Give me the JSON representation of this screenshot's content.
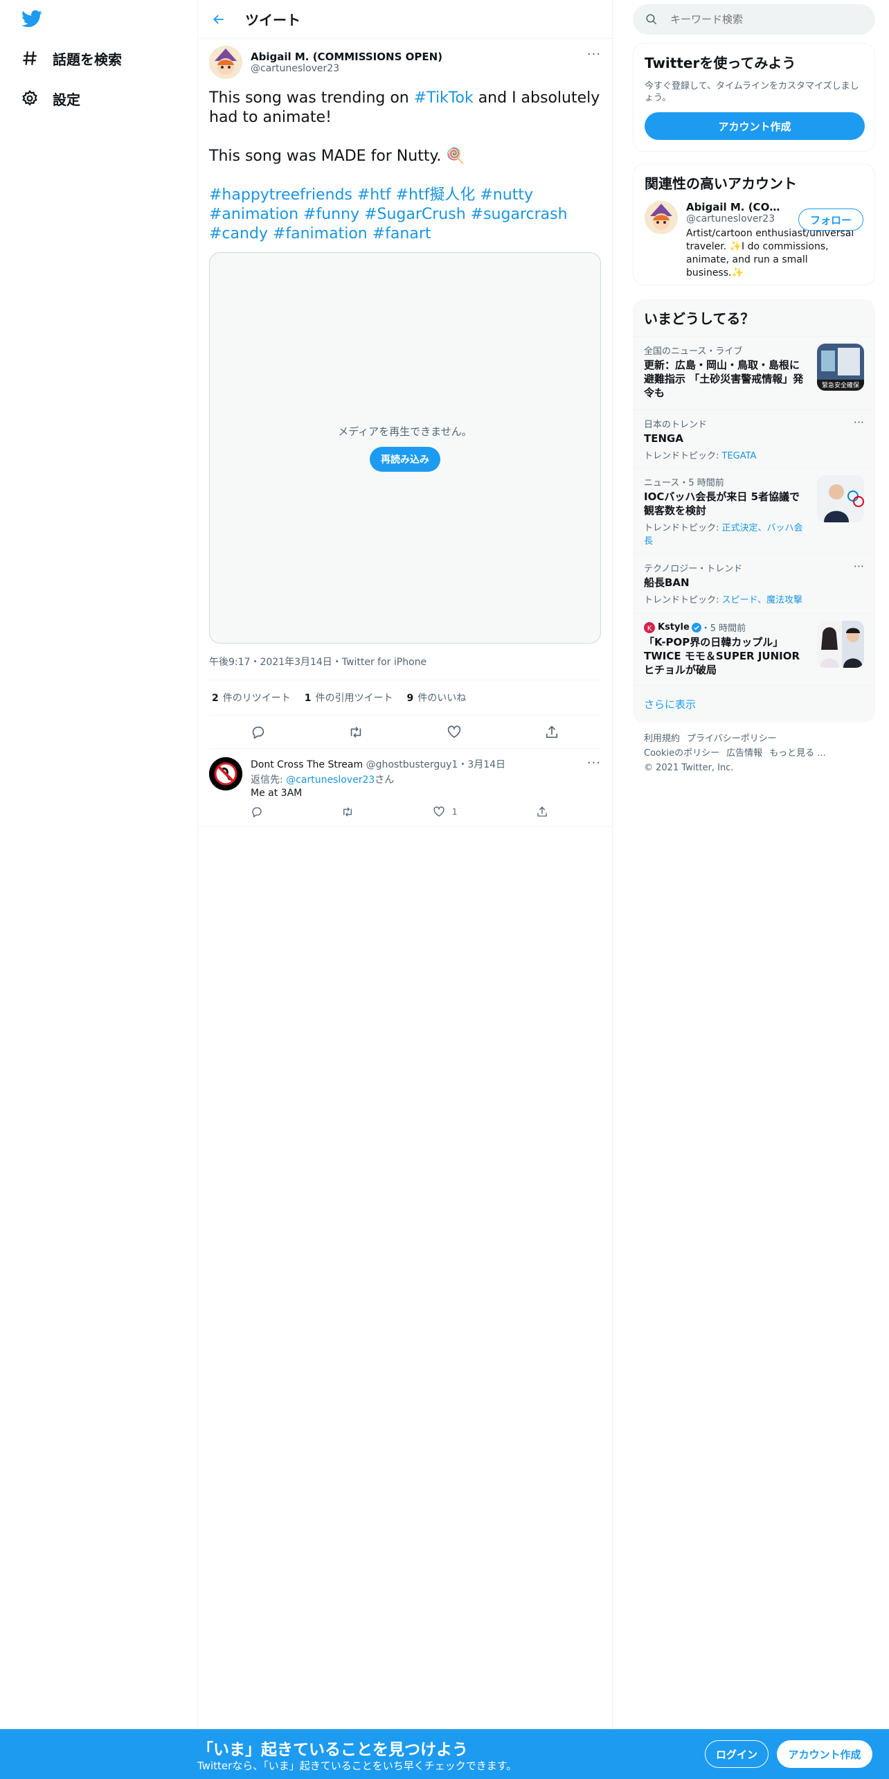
{
  "nav": {
    "explore": "話題を検索",
    "settings": "設定"
  },
  "header": {
    "title": "ツイート"
  },
  "tweet": {
    "name": "Abigail M. (COMMISSIONS OPEN)",
    "handle": "@cartuneslover23",
    "line1_pre": "This song was trending on ",
    "line1_tag": "#TikTok",
    "line1_post": " and I absolutely had to animate!",
    "line2": "This song was MADE for Nutty. 🍭",
    "hashtags": [
      "#happytreefriends",
      "#htf",
      "#htf擬人化",
      "#nutty",
      "#animation",
      "#funny",
      "#SugarCrush",
      "#sugarcrash",
      "#candy",
      "#fanimation",
      "#fanart"
    ],
    "media_message": "メディアを再生できません。",
    "reload": "再読み込み",
    "meta": "午後9:17・2021年3月14日・Twitter for iPhone",
    "retweets": "2",
    "retweets_label": "件のリツイート",
    "quotes": "1",
    "quotes_label": "件の引用ツイート",
    "likes": "9",
    "likes_label": "件のいいね"
  },
  "reply": {
    "name": "Dont Cross The Stream",
    "handle": "@ghostbusterguy1",
    "date": "・3月14日",
    "reply_to_prefix": "返信先: ",
    "reply_to": "@cartuneslover23",
    "reply_to_suffix": "さん",
    "text": "Me at 3AM",
    "like_count": "1"
  },
  "search": {
    "placeholder": "キーワード検索"
  },
  "signup": {
    "title": "Twitterを使ってみよう",
    "sub": "今すぐ登録して、タイムラインをカスタマイズしましょう。",
    "button": "アカウント作成"
  },
  "relevant": {
    "title": "関連性の高いアカウント",
    "name": "Abigail M. (COMMISSIONS OPEN)",
    "handle": "@cartuneslover23",
    "bio": "Artist/cartoon enthusiast/universal traveler. ✨I do commissions, animate, and run a small business.✨",
    "follow": "フォロー"
  },
  "trends": {
    "title": "いまどうしてる？",
    "items": [
      {
        "cat": "全国のニュース・ライブ",
        "title": "更新：広島・岡山・鳥取・島根に避難指示 「土砂災害警戒情報」発令も",
        "sub_prefix": "",
        "sub_links": "",
        "thumb_text": "緊急安全確保"
      },
      {
        "cat": "日本のトレンド",
        "title": "TENGA",
        "sub_prefix": "トレンドトピック: ",
        "sub_links": "TEGATA"
      },
      {
        "cat": "ニュース・5 時間前",
        "title": "IOCバッハ会長が来日 5者協議で観客数を検討",
        "sub_prefix": "トレンドトピック: ",
        "sub_links": "正式決定、バッハ会長"
      },
      {
        "cat": "テクノロジー・トレンド",
        "title": "船長BAN",
        "sub_prefix": "トレンドトピック: ",
        "sub_links": "スピード、魔法攻撃"
      },
      {
        "cat_user": "Kstyle",
        "cat_time": "・5 時間前",
        "title": "「K-POP界の日韓カップル」TWICE モモ＆SUPER JUNIOR ヒチョルが破局",
        "sub_prefix": "",
        "sub_links": ""
      }
    ],
    "show_more": "さらに表示"
  },
  "footer": {
    "terms": "利用規約",
    "privacy": "プライバシーポリシー",
    "cookie": "Cookieのポリシー",
    "ads": "広告情報",
    "more": "もっと見る ...",
    "copy": "© 2021 Twitter, Inc."
  },
  "bottom": {
    "headline": "「いま」起きていることを見つけよう",
    "sub": "Twitterなら、「いま」起きていることをいち早くチェックできます。",
    "login": "ログイン",
    "signup": "アカウント作成"
  },
  "colors": {
    "accent": "#1d9bf0",
    "link": "#1b95e0",
    "text": "#0f1419",
    "muted": "#536471"
  }
}
